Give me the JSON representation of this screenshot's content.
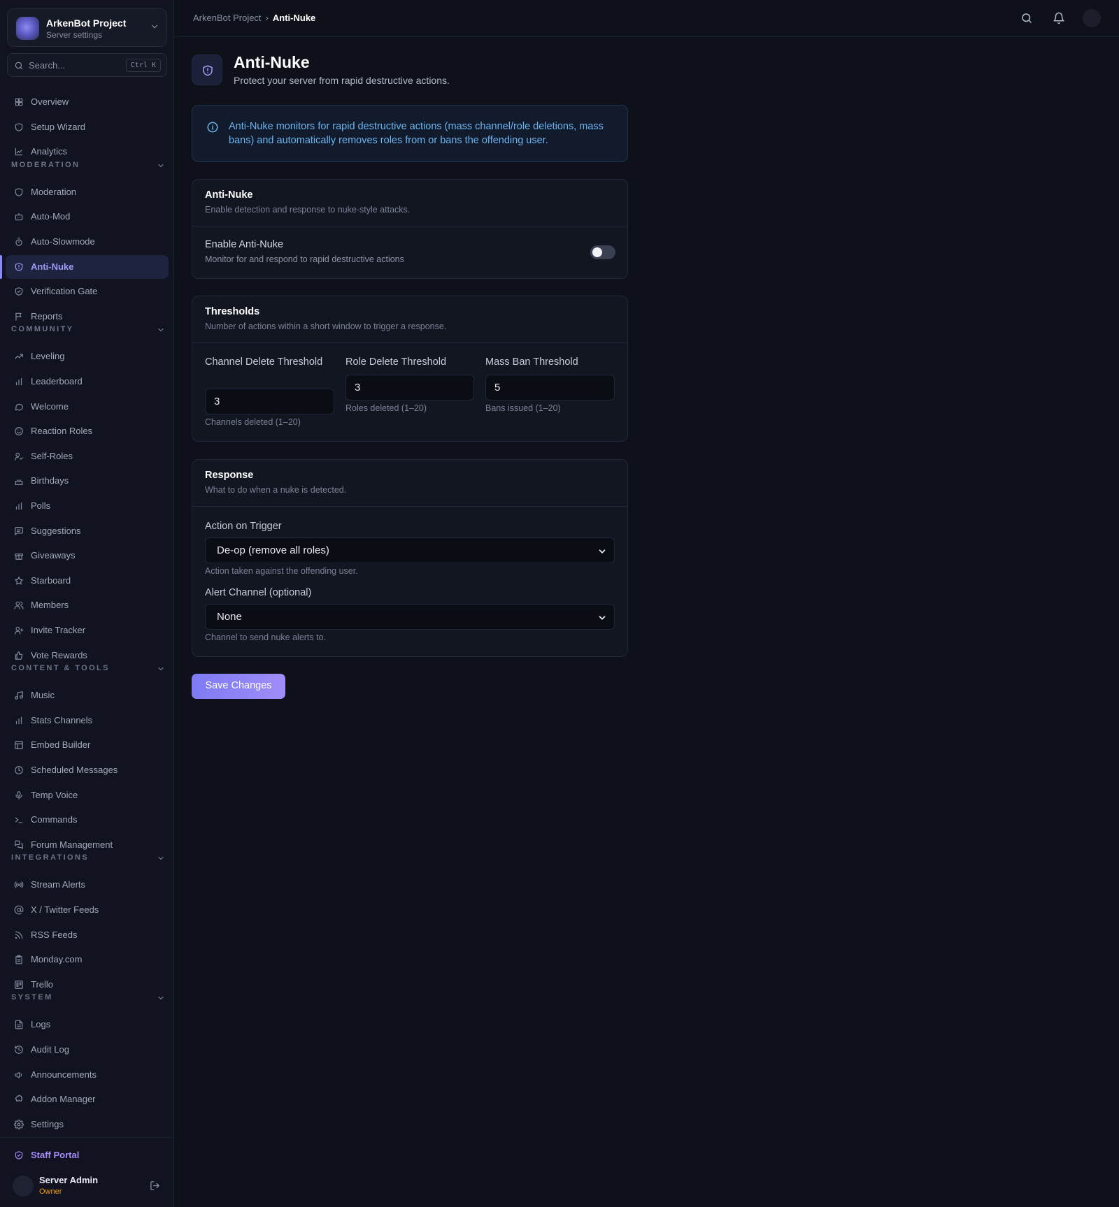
{
  "project": {
    "name": "ArkenBot Project",
    "subtitle": "Server settings"
  },
  "search": {
    "placeholder": "Search...",
    "shortcut": "Ctrl K"
  },
  "sidebar": {
    "top": [
      {
        "label": "Overview",
        "icon": "grid-icon"
      },
      {
        "label": "Setup Wizard",
        "icon": "shield-icon"
      },
      {
        "label": "Analytics",
        "icon": "chart-line-icon"
      }
    ],
    "sections": [
      {
        "title": "MODERATION",
        "items": [
          {
            "label": "Moderation",
            "icon": "shield-icon"
          },
          {
            "label": "Auto-Mod",
            "icon": "bot-icon"
          },
          {
            "label": "Auto-Slowmode",
            "icon": "timer-icon"
          },
          {
            "label": "Anti-Nuke",
            "icon": "shield-alert-icon"
          },
          {
            "label": "Verification Gate",
            "icon": "shield-check-icon"
          },
          {
            "label": "Reports",
            "icon": "flag-icon"
          }
        ]
      },
      {
        "title": "COMMUNITY",
        "items": [
          {
            "label": "Leveling",
            "icon": "trending-up-icon"
          },
          {
            "label": "Leaderboard",
            "icon": "bar-chart-icon"
          },
          {
            "label": "Welcome",
            "icon": "message-icon"
          },
          {
            "label": "Reaction Roles",
            "icon": "smile-icon"
          },
          {
            "label": "Self-Roles",
            "icon": "user-check-icon"
          },
          {
            "label": "Birthdays",
            "icon": "cake-icon"
          },
          {
            "label": "Polls",
            "icon": "bar-chart-icon"
          },
          {
            "label": "Suggestions",
            "icon": "message-square-icon"
          },
          {
            "label": "Giveaways",
            "icon": "gift-icon"
          },
          {
            "label": "Starboard",
            "icon": "star-icon"
          },
          {
            "label": "Members",
            "icon": "users-icon"
          },
          {
            "label": "Invite Tracker",
            "icon": "user-plus-icon"
          },
          {
            "label": "Vote Rewards",
            "icon": "thumbs-up-icon"
          }
        ]
      },
      {
        "title": "CONTENT & TOOLS",
        "items": [
          {
            "label": "Music",
            "icon": "music-icon"
          },
          {
            "label": "Stats Channels",
            "icon": "bar-chart-icon"
          },
          {
            "label": "Embed Builder",
            "icon": "layout-icon"
          },
          {
            "label": "Scheduled Messages",
            "icon": "clock-icon"
          },
          {
            "label": "Temp Voice",
            "icon": "mic-icon"
          },
          {
            "label": "Commands",
            "icon": "terminal-icon"
          },
          {
            "label": "Forum Management",
            "icon": "forum-icon"
          }
        ]
      },
      {
        "title": "INTEGRATIONS",
        "items": [
          {
            "label": "Stream Alerts",
            "icon": "radio-icon"
          },
          {
            "label": "X / Twitter Feeds",
            "icon": "at-sign-icon"
          },
          {
            "label": "RSS Feeds",
            "icon": "rss-icon"
          },
          {
            "label": "Monday.com",
            "icon": "clipboard-icon"
          },
          {
            "label": "Trello",
            "icon": "trello-icon"
          }
        ]
      },
      {
        "title": "SYSTEM",
        "items": [
          {
            "label": "Logs",
            "icon": "file-text-icon"
          },
          {
            "label": "Audit Log",
            "icon": "history-icon"
          },
          {
            "label": "Announcements",
            "icon": "megaphone-icon"
          },
          {
            "label": "Addon Manager",
            "icon": "puzzle-icon"
          },
          {
            "label": "Settings",
            "icon": "gear-icon"
          }
        ]
      }
    ],
    "active": "Anti-Nuke",
    "staff_portal": "Staff Portal",
    "user": {
      "name": "Server Admin",
      "role": "Owner"
    }
  },
  "breadcrumb": {
    "root": "ArkenBot Project",
    "current": "Anti-Nuke"
  },
  "page": {
    "title": "Anti-Nuke",
    "subtitle": "Protect your server from rapid destructive actions."
  },
  "info": {
    "text": "Anti-Nuke monitors for rapid destructive actions (mass channel/role deletions, mass bans) and automatically removes roles from or bans the offending user."
  },
  "cards": {
    "anti_nuke": {
      "title": "Anti-Nuke",
      "subtitle": "Enable detection and response to nuke-style attacks.",
      "toggle_label": "Enable Anti-Nuke",
      "toggle_desc": "Monitor for and respond to rapid destructive actions",
      "enabled": false
    },
    "thresholds": {
      "title": "Thresholds",
      "subtitle": "Number of actions within a short window to trigger a response.",
      "fields": [
        {
          "label": "Channel Delete Threshold",
          "value": "3",
          "hint": "Channels deleted (1–20)"
        },
        {
          "label": "Role Delete Threshold",
          "value": "3",
          "hint": "Roles deleted (1–20)"
        },
        {
          "label": "Mass Ban Threshold",
          "value": "5",
          "hint": "Bans issued (1–20)"
        }
      ]
    },
    "response": {
      "title": "Response",
      "subtitle": "What to do when a nuke is detected.",
      "action_label": "Action on Trigger",
      "action_value": "De-op (remove all roles)",
      "action_hint": "Action taken against the offending user.",
      "alert_label": "Alert Channel (optional)",
      "alert_value": "None",
      "alert_hint": "Channel to send nuke alerts to."
    }
  },
  "save_label": "Save Changes",
  "colors": {
    "accent": "#8b89f6",
    "info": "#6cb4f0",
    "owner": "#f59e0b",
    "staff": "#a78bfa"
  }
}
